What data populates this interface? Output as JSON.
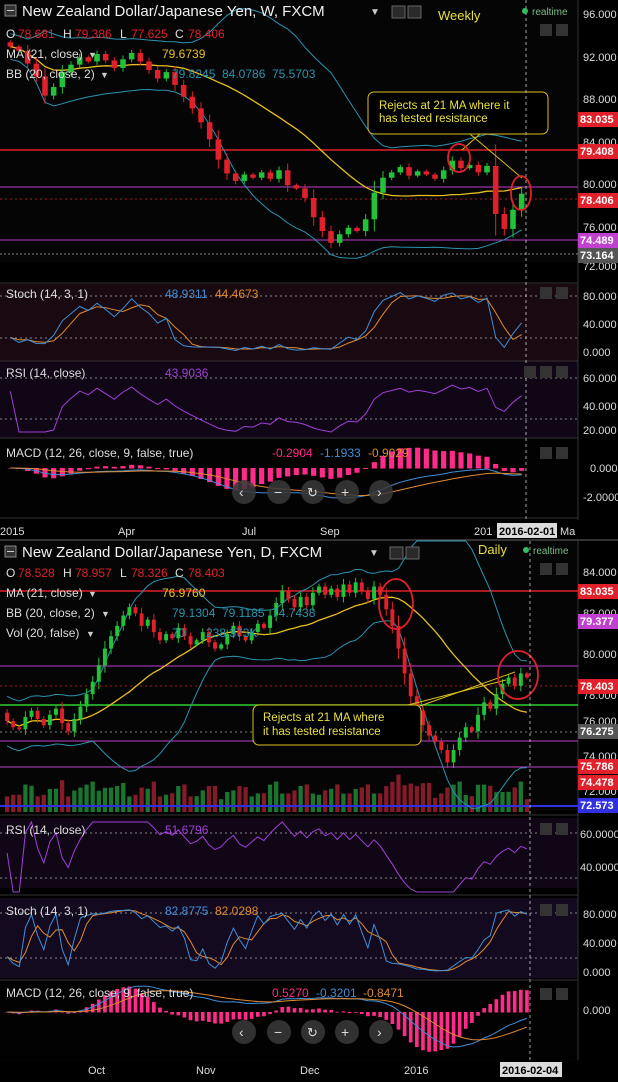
{
  "colors": {
    "bg": "#000000",
    "up": "#22c23a",
    "down": "#e0202a",
    "ma": "#e8c020",
    "bb": "#2a93b0",
    "stoch_k": "#3f8fd8",
    "stoch_d": "#e08a30",
    "rsi": "#a040d8",
    "macd_hist": "#ff2a8a",
    "resistance": "#e0202a",
    "support_magenta": "#c040d0",
    "support_green": "#30d030",
    "annotation_border": "#d8c020",
    "annotation_text": "#e8e040"
  },
  "weekly": {
    "title": "New Zealand Dollar/Japanese Yen, W, FXCM",
    "timeframe_label": "Weekly",
    "realtime_label": "realtime",
    "ohlc": {
      "o_label": "O",
      "o": "78.681",
      "h_label": "H",
      "h": "79.386",
      "l_label": "L",
      "l": "77.625",
      "c_label": "C",
      "c": "78.406"
    },
    "ma_label": "MA (21, close)",
    "ma_value": "79.6739",
    "bb_label": "BB (20, close, 2)",
    "bb_values": [
      "79.8245",
      "84.0786",
      "75.5703"
    ],
    "annotation": [
      "Rejects at 21 MA where it",
      "has tested resistance"
    ],
    "price_ticks": [
      "96.000",
      "92.000",
      "88.000",
      "84.000",
      "80.000",
      "76.000",
      "72.000"
    ],
    "price_badges": [
      "83.035",
      "79.408",
      "78.406",
      "74.489",
      "73.164"
    ],
    "stoch": {
      "label": "Stoch (14, 3, 1)",
      "values": [
        "48.9311",
        "44.4673"
      ],
      "ticks": [
        "80.000",
        "40.000",
        "0.000"
      ]
    },
    "rsi": {
      "label": "RSI (14, close)",
      "value": "43.9036",
      "ticks": [
        "60.000",
        "40.000",
        "20.000"
      ]
    },
    "macd": {
      "label": "MACD (12, 26, close, 9, false, true)",
      "values": [
        "-0.2904",
        "-1.1933",
        "-0.9029"
      ],
      "ticks": [
        "0.000",
        "-2.0000"
      ]
    },
    "time_labels": [
      "2015",
      "Apr",
      "Jul",
      "Sep",
      "201",
      "Ma"
    ],
    "date_badge": "2016-02-01"
  },
  "daily": {
    "title": "New Zealand Dollar/Japanese Yen, D, FXCM",
    "timeframe_label": "Daily",
    "realtime_label": "realtime",
    "ohlc": {
      "o_label": "O",
      "o": "78.528",
      "h_label": "H",
      "h": "78.957",
      "l_label": "L",
      "l": "78.326",
      "c_label": "C",
      "c": "78.403"
    },
    "ma_label": "MA (21, close)",
    "ma_value": "76.9760",
    "bb_label": "BB (20, close, 2)",
    "bb_values": [
      "79.1304",
      "79.1185",
      "74.7438"
    ],
    "vol_label": "Vol (20, false)",
    "vol_values": [
      "70",
      "238.373K"
    ],
    "annotation": [
      "Rejects at 21 MA where",
      "it has tested resistance"
    ],
    "price_ticks": [
      "84.000",
      "82.000",
      "80.000",
      "78.000",
      "76.000",
      "74.000",
      "72.000"
    ],
    "price_badges": [
      "83.035",
      "79.377",
      "78.403",
      "76.275",
      "75.786",
      "74.478",
      "72.573"
    ],
    "rsi": {
      "label": "RSI (14, close)",
      "value": "51.6796",
      "ticks": [
        "60.0000",
        "40.0000"
      ]
    },
    "stoch": {
      "label": "Stoch (14, 3, 1)",
      "values": [
        "82.8775",
        "82.0298"
      ],
      "ticks": [
        "80.000",
        "40.000",
        "0.000"
      ]
    },
    "macd": {
      "label": "MACD (12, 26, close, 9, false, true)",
      "values": [
        "0.5270",
        "-0.3201",
        "-0.8471"
      ],
      "ticks": [
        "0.000"
      ]
    },
    "time_labels": [
      "Oct",
      "Nov",
      "Dec",
      "2016"
    ],
    "date_badge": "2016-02-04"
  },
  "chart_data": [
    {
      "type": "candlestick",
      "title": "New Zealand Dollar/Japanese Yen, W, FXCM",
      "ylim": [
        72,
        96
      ],
      "resistance_levels": [
        83.035,
        79.408
      ],
      "support_levels": [
        74.489,
        73.164
      ],
      "last_close": 78.406,
      "closes": [
        92.2,
        91.8,
        90.6,
        89.4,
        87.6,
        88.4,
        89.8,
        90.5,
        91.2,
        90.8,
        91.5,
        90.9,
        90.2,
        91.0,
        91.6,
        90.8,
        90.0,
        89.2,
        89.8,
        88.6,
        87.5,
        86.4,
        85.1,
        83.5,
        81.6,
        80.3,
        79.6,
        80.2,
        79.9,
        80.4,
        79.8,
        80.6,
        79.2,
        78.9,
        78.0,
        76.2,
        74.9,
        73.8,
        74.6,
        75.2,
        74.9,
        76.0,
        78.5,
        79.9,
        80.4,
        80.9,
        80.1,
        80.5,
        80.2,
        79.8,
        80.6,
        81.5,
        80.8,
        81.1,
        80.4,
        81.0,
        76.5,
        75.1,
        76.9,
        78.406
      ]
    },
    {
      "type": "candlestick",
      "title": "New Zealand Dollar/Japanese Yen, D, FXCM",
      "ylim": [
        72,
        85
      ],
      "resistance_levels": [
        83.035,
        79.377
      ],
      "support_levels": [
        76.275,
        75.786,
        74.478,
        72.573
      ],
      "last_close": 78.403,
      "closes": [
        76.3,
        76.0,
        75.9,
        76.5,
        76.8,
        76.4,
        76.1,
        76.6,
        76.9,
        76.2,
        75.8,
        76.4,
        77.0,
        77.6,
        78.2,
        79.0,
        79.8,
        80.4,
        80.9,
        81.4,
        81.8,
        81.5,
        80.9,
        81.2,
        80.6,
        80.2,
        80.5,
        80.3,
        80.8,
        80.4,
        80.0,
        80.2,
        80.6,
        80.1,
        79.8,
        80.0,
        80.5,
        80.9,
        80.4,
        80.2,
        80.6,
        81.0,
        80.8,
        81.4,
        82.0,
        82.6,
        82.2,
        81.8,
        82.3,
        81.9,
        82.5,
        82.8,
        82.4,
        82.7,
        82.3,
        82.9,
        82.5,
        83.0,
        82.6,
        82.2,
        82.8,
        82.4,
        81.7,
        80.9,
        79.8,
        78.6,
        77.5,
        76.8,
        76.1,
        75.6,
        75.3,
        74.9,
        74.3,
        74.9,
        75.5,
        76.0,
        75.8,
        76.6,
        77.2,
        76.9,
        77.6,
        78.1,
        78.4,
        78.0,
        78.6,
        78.403
      ]
    }
  ]
}
